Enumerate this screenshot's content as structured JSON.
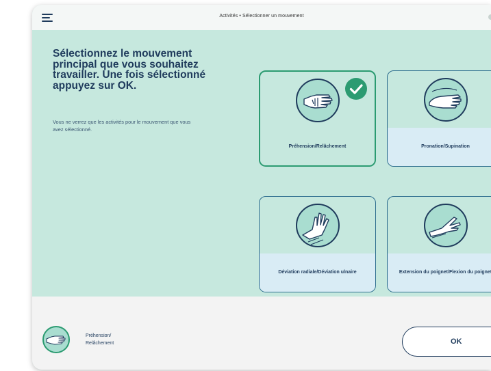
{
  "header": {
    "breadcrumb": "Activités • Sélectionner un mouvement"
  },
  "intro": {
    "title": "Sélectionnez le mouvement principal que vous souhaitez travailler. Une fois sélectionné appuyez sur OK.",
    "description": "Vous ne verrez que les activités pour le mouvement que vous avez sélectionné."
  },
  "movements": [
    {
      "label": "Préhension/Relâchement",
      "icon": "grasp-release-hand-icon",
      "selected": true
    },
    {
      "label": "Pronation/Supination",
      "icon": "pronation-supination-hand-icon",
      "selected": false
    },
    {
      "label": "Déviation radiale/Déviation ulnaire",
      "icon": "radial-ulnar-deviation-hand-icon",
      "selected": false
    },
    {
      "label": "Extension du poignet/Flexion du poignet",
      "icon": "wrist-extension-flexion-hand-icon",
      "selected": false
    }
  ],
  "footer": {
    "selected_label": "Préhension/ Relâchement",
    "ok_label": "OK"
  },
  "colors": {
    "background": "#c6e8de",
    "card_border": "#2d6d8e",
    "selected_border": "#2b9b71",
    "text": "#1f3b5c",
    "label_band": "#d9ecf5"
  }
}
